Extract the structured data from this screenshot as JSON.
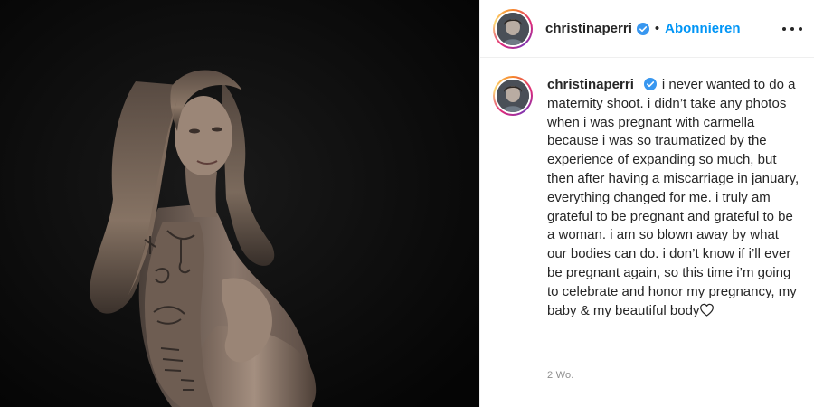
{
  "post": {
    "author": "christinaperri",
    "follow_label": "Abonnieren",
    "more_icon": "more-horizontal-icon",
    "verified_icon": "verified-badge-icon",
    "caption": {
      "username": "christinaperri",
      "text": "i never wanted to do a maternity shoot. i didn’t take any photos when i was pregnant with carmella because i was so traumatized by the experience of expanding so much, but then after having a miscarriage in january, everything changed for me. i truly am grateful to be pregnant and grateful to be a woman. i am so blown away by what our bodies can do. i don’t know if i’ll ever be pregnant again, so this time i’m going to celebrate and honor my pregnancy, my baby & my beautiful body",
      "end_icon": "heart-outline-icon"
    },
    "timestamp": "2 Wo."
  },
  "colors": {
    "link_blue": "#0095f6",
    "text": "#262626",
    "muted": "#8e8e8e",
    "verified_blue": "#3897f0",
    "photo_bg": "#0b0b0b"
  }
}
